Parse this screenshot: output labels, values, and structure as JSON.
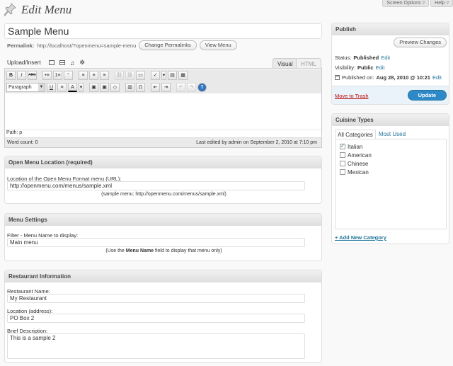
{
  "top_links": {
    "screen_options": "Screen Options ▿",
    "help": "Help ▿"
  },
  "page": {
    "title": "Edit Menu",
    "post_title": "Sample Menu"
  },
  "permalink": {
    "label": "Permalink:",
    "url": "http://localhost/?openmenu=sample-menu",
    "change_btn": "Change Permalinks",
    "view_btn": "View Menu"
  },
  "upload": {
    "label": "Upload/Insert"
  },
  "editor": {
    "tab_visual": "Visual",
    "tab_html": "HTML",
    "format_select": "Paragraph",
    "row1": [
      "B",
      "I",
      "ABC",
      "•≡",
      "1≡",
      "“",
      "≡",
      "≡",
      "≡",
      "⛓",
      "⛓",
      "▭",
      "✓",
      "▤",
      "▦"
    ],
    "row2": [
      "U",
      "≡",
      "A",
      "▣",
      "▣",
      "◇",
      "▥",
      "Ω",
      "⇤",
      "⇥",
      "↶",
      "↷",
      "?"
    ],
    "path": "Path: p",
    "word_count": "Word count: 0",
    "last_edited": "Last edited by admin on September 2, 2010 at 7:10 pm"
  },
  "location_box": {
    "title": "Open Menu Location (required)",
    "label": "Location of the Open Menu Format menu (URL):",
    "value": "http://openmenu.com/menus/sample.xml",
    "hint": "(sample menu: http://openmenu.com/menus/sample.xml)"
  },
  "settings_box": {
    "title": "Menu Settings",
    "label": "Filter - Menu Name to display:",
    "value": "Main menu",
    "hint_pre": "(Use the ",
    "hint_bold": "Menu Name",
    "hint_post": " field to display that menu only)"
  },
  "restaurant_box": {
    "title": "Restaurant Information",
    "name_label": "Restaurant Name:",
    "name_value": "My Restaurant",
    "loc_label": "Location (address):",
    "loc_value": "PO Box 2",
    "desc_label": "Brief Description:",
    "desc_value": "This is a sample 2"
  },
  "publish": {
    "title": "Publish",
    "preview_btn": "Preview Changes",
    "status_label": "Status:",
    "status_value": "Published",
    "status_edit": "Edit",
    "visibility_label": "Visibility:",
    "visibility_value": "Public",
    "visibility_edit": "Edit",
    "published_label": "Published on:",
    "published_value": "Aug 28, 2010 @ 10:21",
    "published_edit": "Edit",
    "trash": "Move to Trash",
    "update_btn": "Update"
  },
  "cuisine": {
    "title": "Cuisine Types",
    "tab_all": "All Categories",
    "tab_used": "Most Used",
    "items": [
      {
        "label": "Italian",
        "checked": true
      },
      {
        "label": "American",
        "checked": false
      },
      {
        "label": "Chinese",
        "checked": false
      },
      {
        "label": "Mexican",
        "checked": false
      }
    ],
    "add_new": "+ Add New Category"
  },
  "colors": {
    "link": "#21759b",
    "update_button": "#2e89c8",
    "trash": "#bc0b0b",
    "checkbox_tick": "#1a6e1a"
  }
}
